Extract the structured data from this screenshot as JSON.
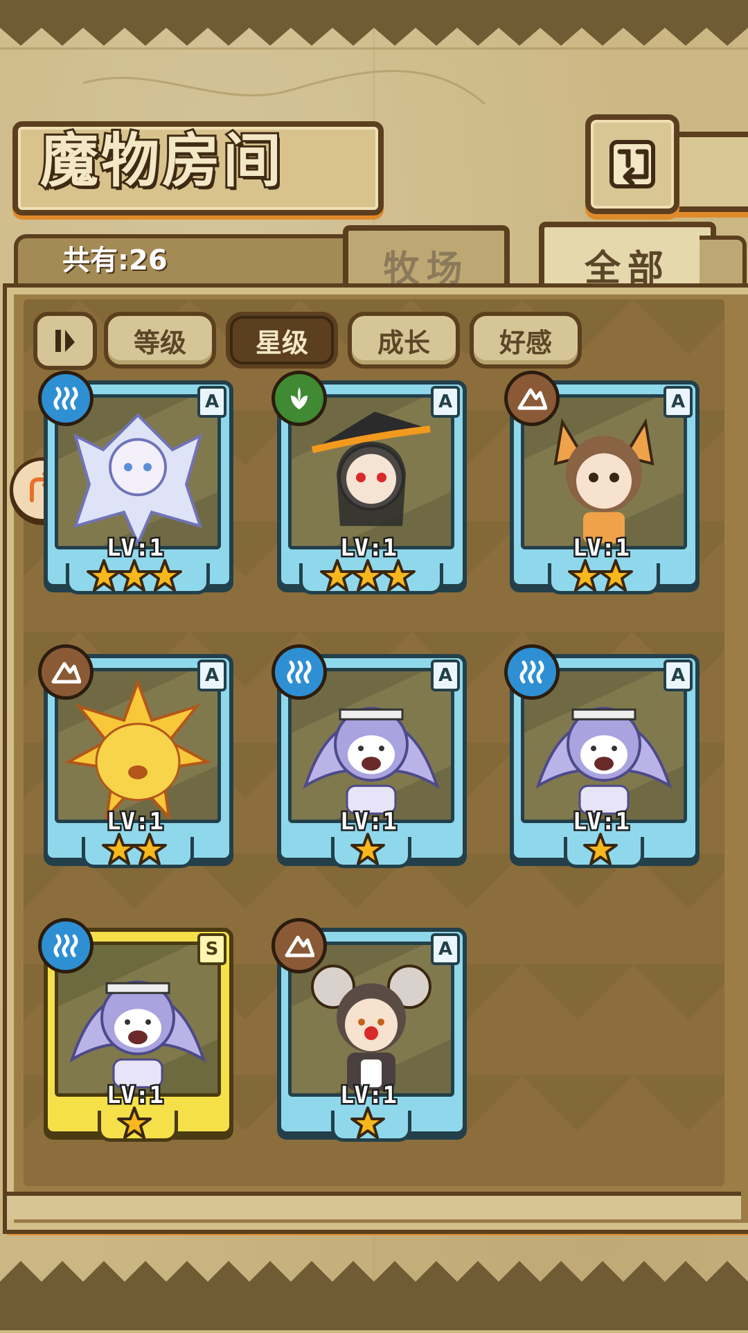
{
  "header": {
    "title": "魔物房间",
    "count_text": "共有:26"
  },
  "tabs": [
    {
      "label": "牧场",
      "selected": false
    },
    {
      "label": "全部",
      "selected": true
    }
  ],
  "sort_buttons": [
    {
      "label": "等级",
      "active": false
    },
    {
      "label": "星级",
      "active": true
    },
    {
      "label": "成长",
      "active": false
    },
    {
      "label": "好感",
      "active": false
    }
  ],
  "monsters": [
    {
      "element": "water",
      "grade": "A",
      "level": "LV:1",
      "stars": 3,
      "frame": "blue",
      "character": "ice-crystal-girl"
    },
    {
      "element": "wood",
      "grade": "A",
      "level": "LV:1",
      "stars": 3,
      "frame": "blue",
      "character": "witch-girl"
    },
    {
      "element": "earth",
      "grade": "A",
      "level": "LV:1",
      "stars": 2,
      "frame": "blue",
      "character": "fox-girl"
    },
    {
      "element": "earth",
      "grade": "A",
      "level": "LV:1",
      "stars": 2,
      "frame": "blue",
      "character": "gold-slime"
    },
    {
      "element": "water",
      "grade": "A",
      "level": "LV:1",
      "stars": 1,
      "frame": "blue",
      "character": "harpy-girl"
    },
    {
      "element": "water",
      "grade": "A",
      "level": "LV:1",
      "stars": 1,
      "frame": "blue",
      "character": "harpy-girl"
    },
    {
      "element": "water",
      "grade": "S",
      "level": "LV:1",
      "stars": 1,
      "frame": "gold",
      "character": "harpy-girl"
    },
    {
      "element": "earth",
      "grade": "A",
      "level": "LV:1",
      "stars": 1,
      "frame": "blue",
      "character": "mouse-girl"
    }
  ],
  "colors": {
    "frame_blue": "#8fd8ec",
    "frame_gold": "#f5e04a",
    "element_water": "#2e8fd3",
    "element_earth": "#8a5a36",
    "element_wood": "#3f8a32",
    "star": "#f7b81e"
  },
  "icons": {
    "back": "back-arrow-icon",
    "sort_toggle": "sort-order-icon",
    "side": "redirect-arrow-icon"
  }
}
